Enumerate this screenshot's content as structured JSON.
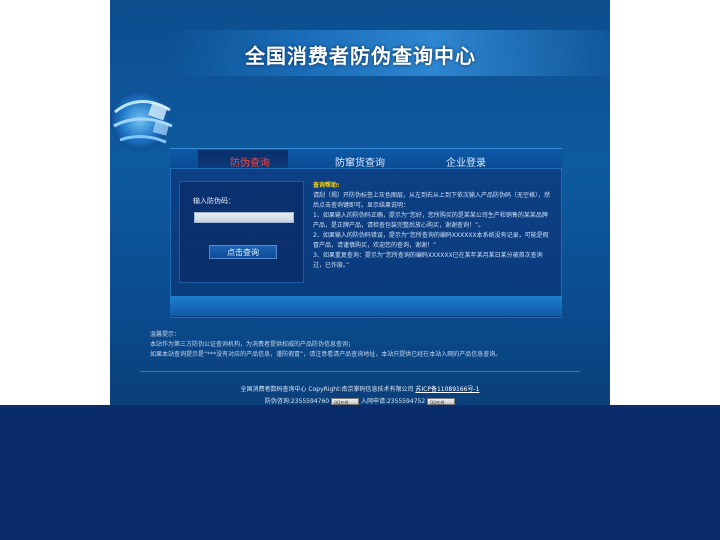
{
  "site": {
    "title": "全国消费者防伪查询中心"
  },
  "tabs": [
    {
      "label": "防伪查询",
      "active": true
    },
    {
      "label": "防窜货查询",
      "active": false
    },
    {
      "label": "企业登录",
      "active": false
    }
  ],
  "query": {
    "input_label": "输入防伪码：",
    "input_value": "",
    "button_label": "点击查询"
  },
  "help": {
    "title": "查询帮助:",
    "lines": [
      "请刮（揭）开防伪标签上灰色图层，从左到右从上到下依次输入产品防伪码（无空格），然后点击查询键即可。显示结果说明：",
      "1、如果输入的防伪码正确，提示为“您好，您所购买的是某某公司生产和销售的某某品牌产品，是正牌产品，请检查包装完整后放心购买，谢谢查询！”。",
      "2、如果输入的防伪码错误，提示为“您所查询的编码XXXXXX本系统没有记录，可能是假冒产品，请谨慎购买，欢迎您的查询，谢谢！”",
      "3、如果重复查询：提示为“您所查询的编码XXXXXX已在某年某月某日某分被首次查询过，已作废。”"
    ]
  },
  "notice": {
    "title": "温馨提示：",
    "lines": [
      "本站作为第三方防伪公证查询机构，为消费者提供权威的产品防伪信息查询；",
      "如果本站查询提示是“***没有对应的产品信息，谨防假冒”，请注意看清产品查询地址，本站只提供已经在本站入网的产品信息查询。"
    ]
  },
  "footer": {
    "line1_text": "全国消费者数码查询中心  CopyRight:南京掌码信息技术有限公司",
    "icp": "苏ICP备11089166号-1",
    "consult_label": "防伪咨询:2355594760",
    "network_label": "入网申请:2355594752",
    "qq_badge": "QQ在线"
  },
  "colors": {
    "background": "#0a2c6b",
    "active_tab_text": "#e84a4a",
    "help_title": "#ffd700"
  }
}
